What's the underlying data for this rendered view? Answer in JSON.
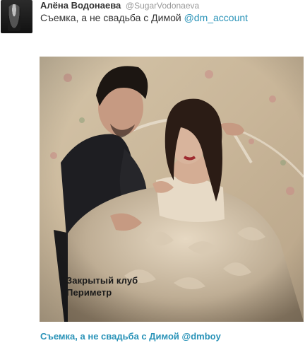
{
  "tweet": {
    "author_name": "Алёна Водонаева",
    "author_handle": "@SugarVodonaeva",
    "text_prefix": "Съемка, а не свадьба с Димой ",
    "mention": "@dm_account"
  },
  "media": {
    "watermark_line1": "Закрытый клуб",
    "watermark_line2": "Периметр"
  },
  "caption": "Съемка, а не свадьба с Димой @dmboy",
  "colors": {
    "link": "#2a93b8",
    "text": "#333333",
    "handle": "#999999"
  }
}
